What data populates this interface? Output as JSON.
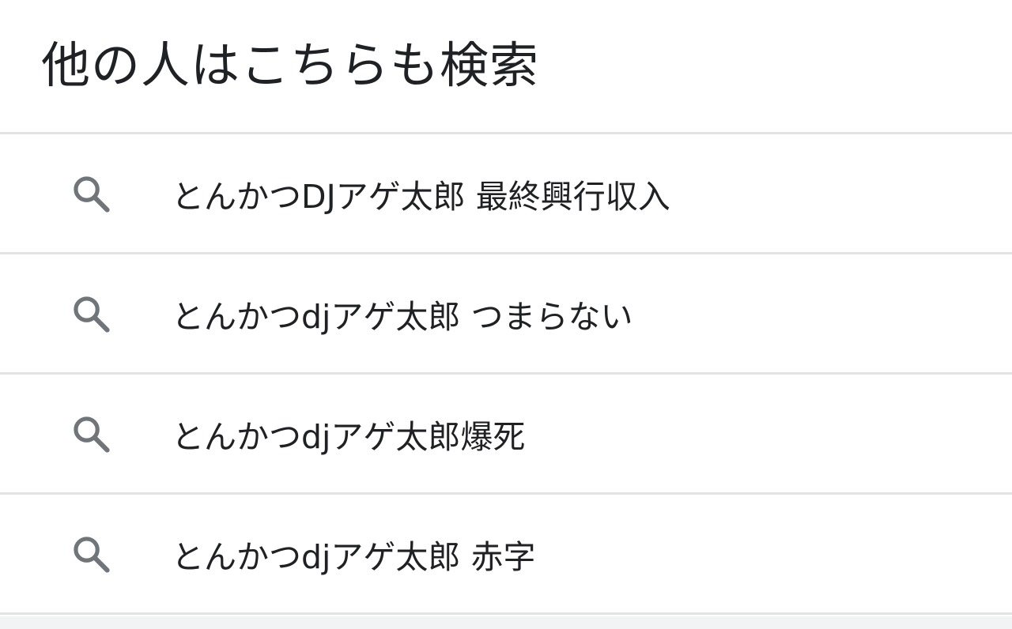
{
  "section": {
    "title": "他の人はこちらも検索"
  },
  "suggestions": [
    {
      "label": "とんかつDJアゲ太郎 最終興行収入",
      "icon": "search-icon"
    },
    {
      "label": "とんかつdjアゲ太郎 つまらない",
      "icon": "search-icon"
    },
    {
      "label": "とんかつdjアゲ太郎爆死",
      "icon": "search-icon"
    },
    {
      "label": "とんかつdjアゲ太郎 赤字",
      "icon": "search-icon"
    }
  ],
  "colors": {
    "text": "#202124",
    "icon": "#70757a",
    "divider": "#e3e3e3",
    "background": "#ffffff",
    "bottom_band": "#f1f3f4"
  }
}
